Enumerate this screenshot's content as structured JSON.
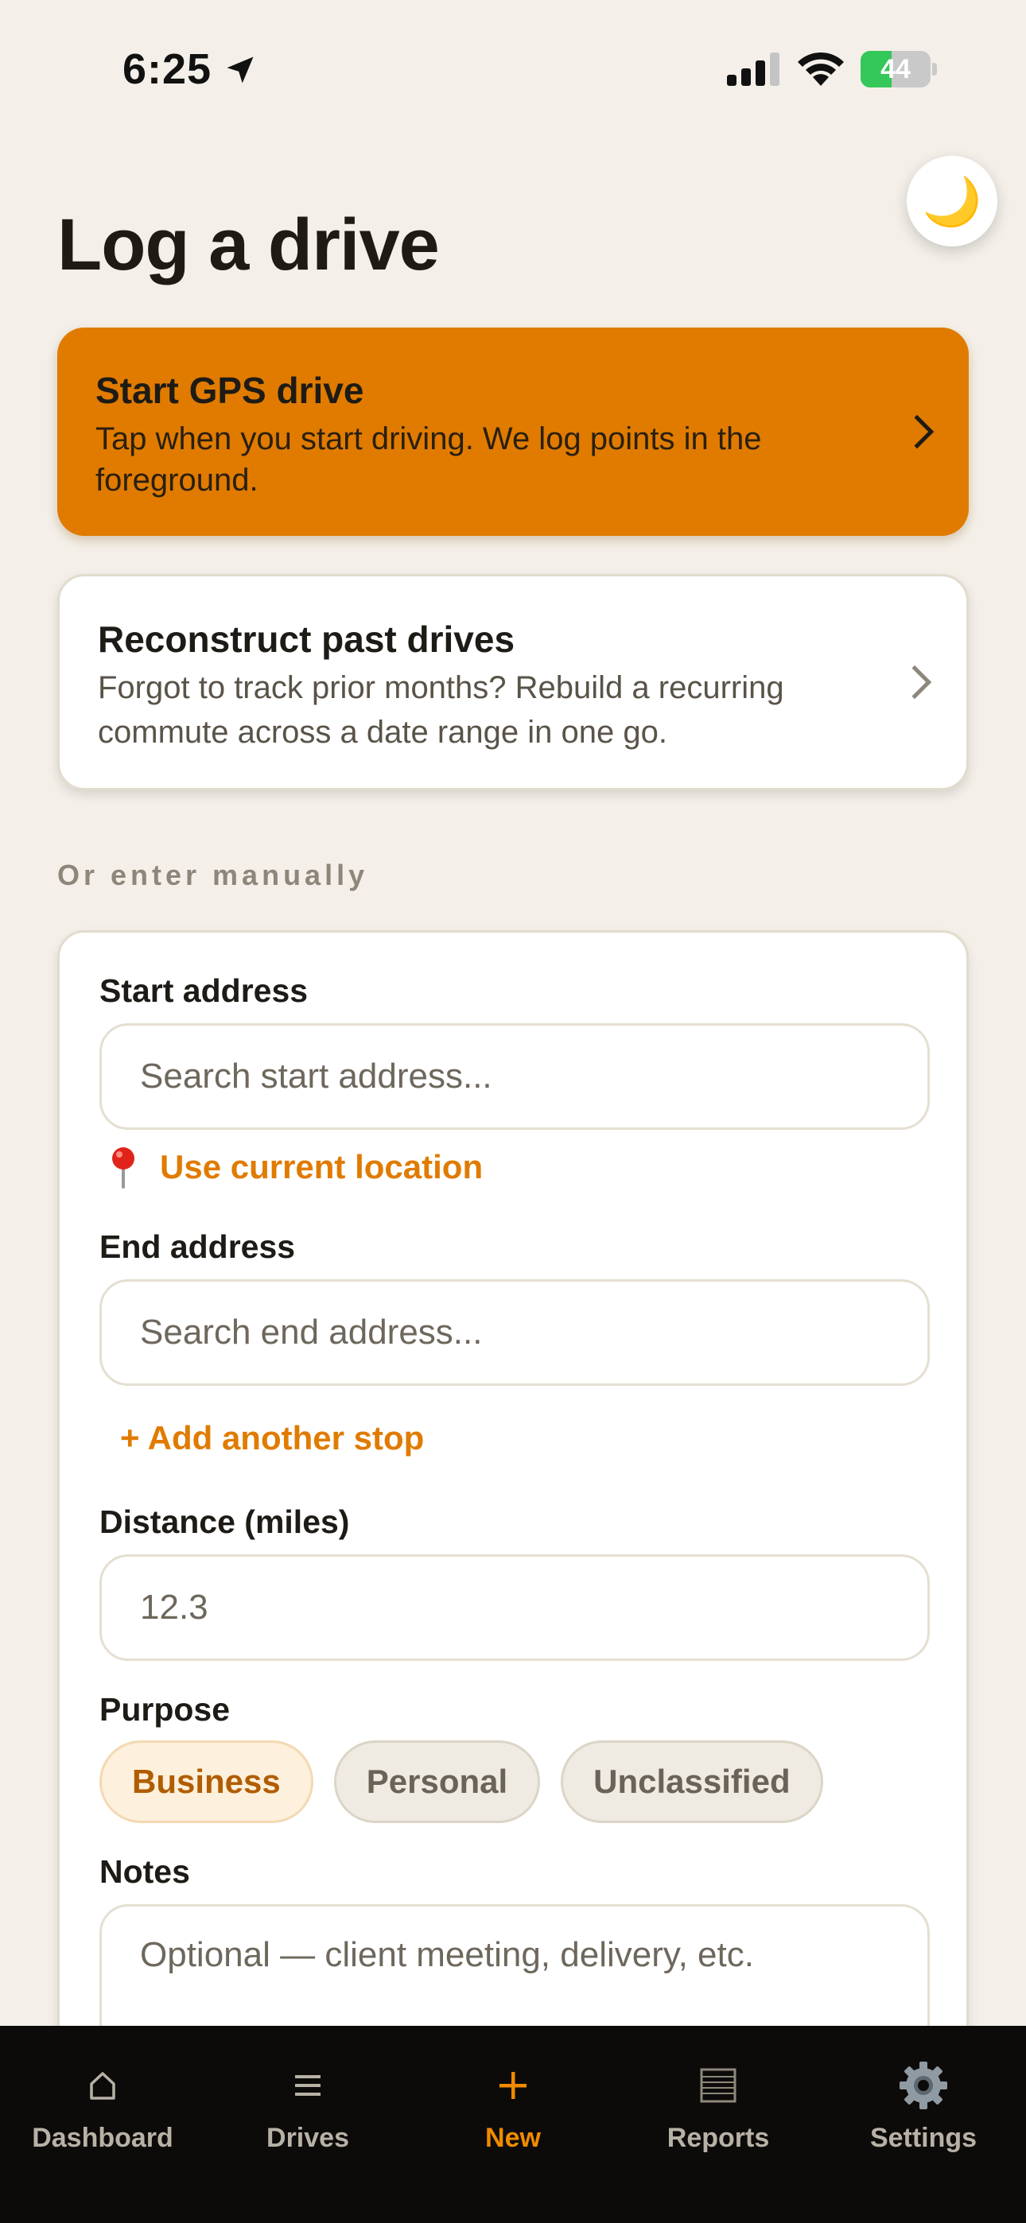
{
  "status_bar": {
    "time": "6:25",
    "battery": "44",
    "battery_level": 0.44
  },
  "theme_toggle": {
    "icon": "moon-icon",
    "glyph": "🌙"
  },
  "page": {
    "title": "Log a drive"
  },
  "cards": {
    "gps": {
      "title": "Start GPS drive",
      "description": "Tap when you start driving. We log points in the foreground."
    },
    "reconstruct": {
      "title": "Reconstruct past drives",
      "description": "Forgot to track prior months? Rebuild a recurring commute across a date range in one go."
    }
  },
  "manual": {
    "section_label": "Or enter manually",
    "start_address": {
      "label": "Start address",
      "placeholder": "Search start address..."
    },
    "use_location": "Use current location",
    "end_address": {
      "label": "End address",
      "placeholder": "Search end address..."
    },
    "add_stop": "+ Add another stop",
    "distance": {
      "label": "Distance (miles)",
      "placeholder": "12.3"
    },
    "purpose": {
      "label": "Purpose",
      "options": [
        "Business",
        "Personal",
        "Unclassified"
      ],
      "selected": "Business"
    },
    "notes": {
      "label": "Notes",
      "placeholder": "Optional — client meeting, delivery, etc."
    }
  },
  "tabs": [
    {
      "label": "Dashboard",
      "icon": "home-icon"
    },
    {
      "label": "Drives",
      "icon": "list-icon"
    },
    {
      "label": "New",
      "icon": "plus-icon",
      "active": true
    },
    {
      "label": "Reports",
      "icon": "report-icon"
    },
    {
      "label": "Settings",
      "icon": "gear-icon"
    }
  ],
  "colors": {
    "accent": "#e07b00",
    "background": "#f4f0e9",
    "tabbar": "#0c0b0a"
  }
}
